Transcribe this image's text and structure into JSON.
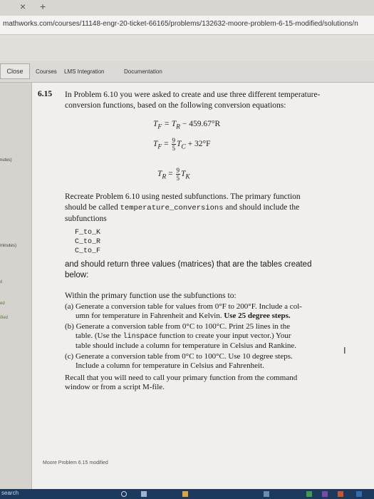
{
  "browser": {
    "tab_close": "×",
    "tab_new": "+",
    "url": "mathworks.com/courses/11148-engr-20-ticket-66165/problems/132632-moore-problem-6-15-modified/solutions/n"
  },
  "toolbar": {
    "close_label": "Close",
    "nav": [
      "Courses",
      "LMS Integration",
      "Documentation"
    ]
  },
  "sidebar": {
    "labels": [
      "nutes)",
      "minutes)",
      "d",
      "ed",
      "ified"
    ]
  },
  "problem": {
    "number": "6.15",
    "intro_line1": "In Problem 6.10 you were asked to create and use three different temperature-",
    "intro_line2": "conversion functions, based on the following conversion equations:",
    "eq1_left": "T",
    "eq1_left_sub": "F",
    "eq1_right": " = T",
    "eq1_right_sub": "R",
    "eq1_rest": " − 459.67°R",
    "eq2_left": "T",
    "eq2_left_sub": "F",
    "eq2_eq": " = ",
    "eq2_num": "9",
    "eq2_den": "5",
    "eq2_t": "T",
    "eq2_t_sub": "C",
    "eq2_rest": " + 32°F",
    "eq3_left": "T",
    "eq3_left_sub": "R",
    "eq3_eq": " = ",
    "eq3_num": "9",
    "eq3_den": "5",
    "eq3_t": "T",
    "eq3_t_sub": "K",
    "recreate_line1": "Recreate Problem 6.10 using nested subfunctions. The primary function",
    "recreate_line2a": "should be called ",
    "recreate_code": "temperature_conversions",
    "recreate_line2b": " and should include the",
    "recreate_line3": "subfunctions",
    "subfunctions": [
      "F_to_K",
      "C_to_R",
      "C_to_F"
    ],
    "return_line1": "and should return three values (matrices) that are the tables created",
    "return_line2": "below:",
    "within": "Within the primary function use the subfunctions to:",
    "item_a_1": "(a) Generate a conversion table for values from 0°F to 200°F. Include a col-",
    "item_a_2": "umn for temperature in Fahrenheit and Kelvin. ",
    "item_a_bold": "Use 25 degree steps.",
    "item_b_1": "(b) Generate a conversion table from 0°C to 100°C. Print 25 lines in the",
    "item_b_2a": "table. (Use the ",
    "item_b_code": "linspace",
    "item_b_2b": " function to create your input vector.) Your",
    "item_b_3": "table should include a column for temperature in Celsius and Rankine.",
    "item_c_1": "(c) Generate a conversion table from 0°C to 100°C.  Use 10 degree steps.",
    "item_c_2": "Include a column for temperature in Celsius and Fahrenheit.",
    "recall_1": "Recall that you will need to call your primary function from the command",
    "recall_2": "window or from a script M-file."
  },
  "footer": {
    "title": "Moore Problem 6.15 modified"
  },
  "taskbar": {
    "search": "search"
  }
}
